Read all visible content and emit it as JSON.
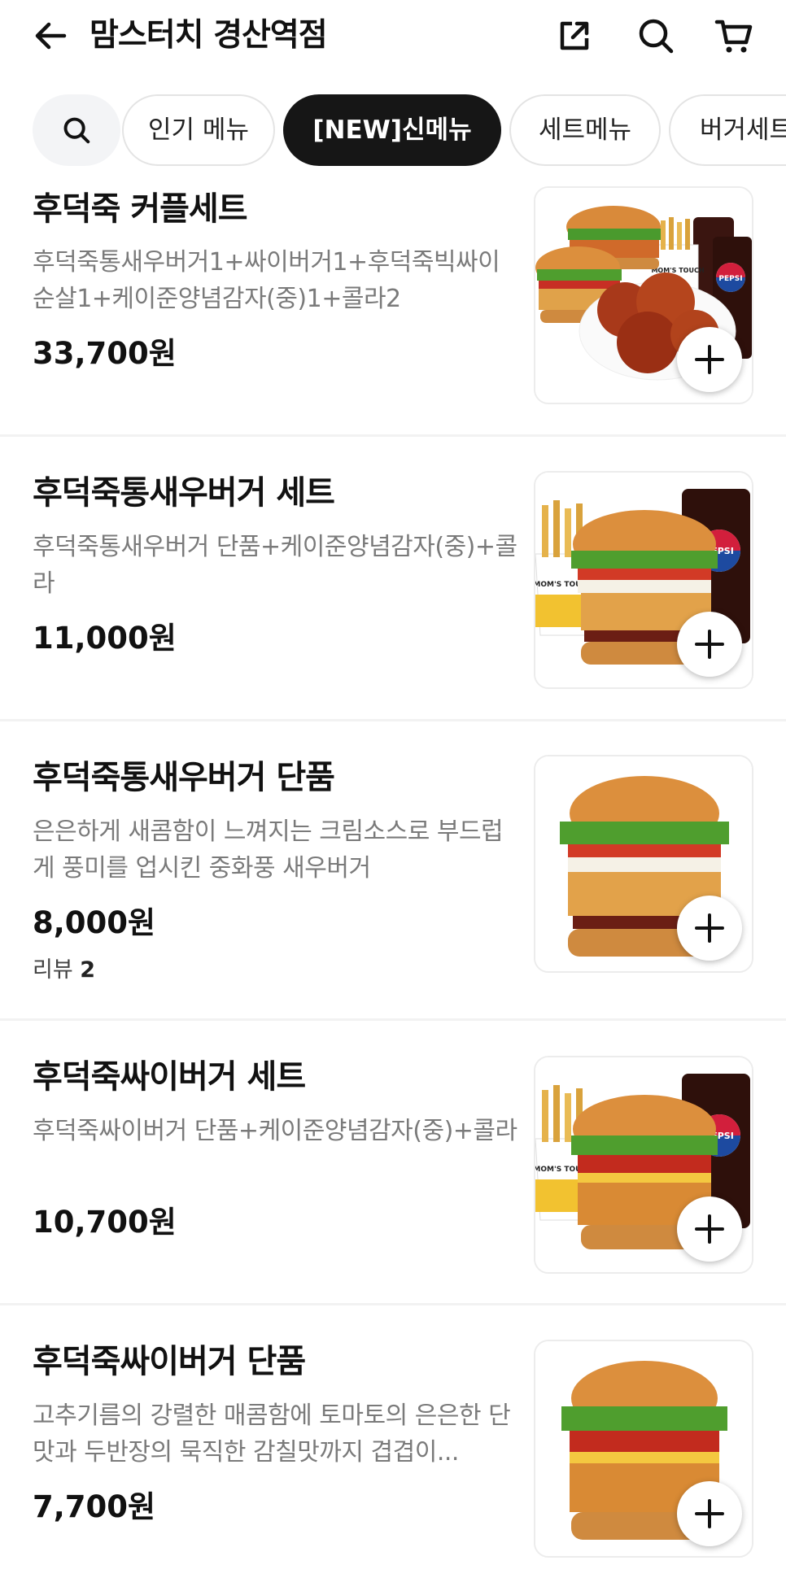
{
  "header": {
    "title": "맘스터치 경산역점",
    "back_icon": "arrow-left-icon",
    "share_icon": "share-icon",
    "search_icon": "search-icon",
    "cart_icon": "cart-icon"
  },
  "categories": {
    "search_icon": "search-icon",
    "items": [
      {
        "label": "인기 메뉴",
        "active": false
      },
      {
        "label": "[NEW]신메뉴",
        "active": true
      },
      {
        "label": "세트메뉴",
        "active": false
      },
      {
        "label": "버거세트",
        "active": false
      }
    ]
  },
  "menu": [
    {
      "name": "후덕죽 커플세트",
      "desc": "후덕죽통새우버거1+싸이버거1+후덕죽빅싸이순살1+케이준양념감자(중)1+콜라2",
      "price": "33,700원"
    },
    {
      "name": "후덕죽통새우버거 세트",
      "desc": "후덕죽통새우버거 단품+케이준양념감자(중)+콜라",
      "price": "11,000원"
    },
    {
      "name": "후덕죽통새우버거 단품",
      "desc": "은은하게 새콤함이 느껴지는 크림소스로 부드럽게 풍미를 업시킨 중화풍 새우버거",
      "price": "8,000원",
      "review_label": "리뷰",
      "review_count": "2"
    },
    {
      "name": "후덕죽싸이버거 세트",
      "desc": "후덕죽싸이버거 단품+케이준양념감자(중)+콜라",
      "price": "10,700원"
    },
    {
      "name": "후덕죽싸이버거 단품",
      "desc": "고추기름의 강렬한 매콤함에 토마토의 은은한 단맛과 두반장의 묵직한 감칠맛까지 겹겹이...",
      "price": "7,700원"
    }
  ],
  "image_text": {
    "brand": "MOM'S TOUCH",
    "drink": "PEPSI"
  },
  "add_icon": "plus-icon"
}
